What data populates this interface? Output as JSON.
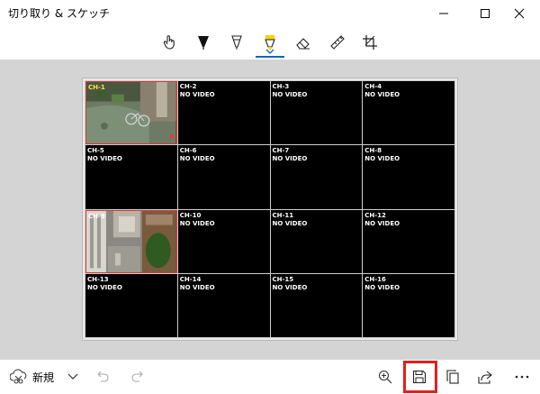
{
  "app": {
    "title": "切り取り & スケッチ"
  },
  "window_controls": [
    "minimize-icon",
    "maximize-icon",
    "close-icon"
  ],
  "tools": [
    {
      "name": "touch-writing-icon"
    },
    {
      "name": "ballpoint-pen-icon"
    },
    {
      "name": "pencil-icon"
    },
    {
      "name": "highlighter-icon",
      "active": true,
      "color": "#f5d300"
    },
    {
      "name": "eraser-icon"
    },
    {
      "name": "ruler-icon"
    },
    {
      "name": "crop-icon"
    }
  ],
  "dvr": {
    "cells": [
      {
        "label": "CH-1",
        "label_color": "yellow",
        "status": "",
        "live": true
      },
      {
        "label": "CH-2",
        "status": "NO VIDEO"
      },
      {
        "label": "CH-3",
        "status": "NO VIDEO"
      },
      {
        "label": "CH-4",
        "status": "NO VIDEO"
      },
      {
        "label": "CH-5",
        "status": "NO VIDEO"
      },
      {
        "label": "CH-6",
        "status": "NO VIDEO"
      },
      {
        "label": "CH-7",
        "status": "NO VIDEO"
      },
      {
        "label": "CH-8",
        "status": "NO VIDEO"
      },
      {
        "label": "CH-9",
        "label_color": "white",
        "status": "",
        "live": true
      },
      {
        "label": "CH-10",
        "status": "NO VIDEO"
      },
      {
        "label": "CH-11",
        "status": "NO VIDEO"
      },
      {
        "label": "CH-12",
        "status": "NO VIDEO"
      },
      {
        "label": "CH-13",
        "status": "NO VIDEO"
      },
      {
        "label": "CH-14",
        "status": "NO VIDEO"
      },
      {
        "label": "CH-15",
        "status": "NO VIDEO"
      },
      {
        "label": "CH-16",
        "status": "NO VIDEO"
      }
    ],
    "rec_mark": "R"
  },
  "bottom": {
    "new_label": "新規",
    "icons": [
      "new-snip-icon",
      "chevron-down-icon",
      "undo-icon",
      "redo-icon",
      "zoom-icon",
      "save-icon",
      "copy-icon",
      "share-icon",
      "more-icon"
    ],
    "highlight_color": "#e02020"
  }
}
